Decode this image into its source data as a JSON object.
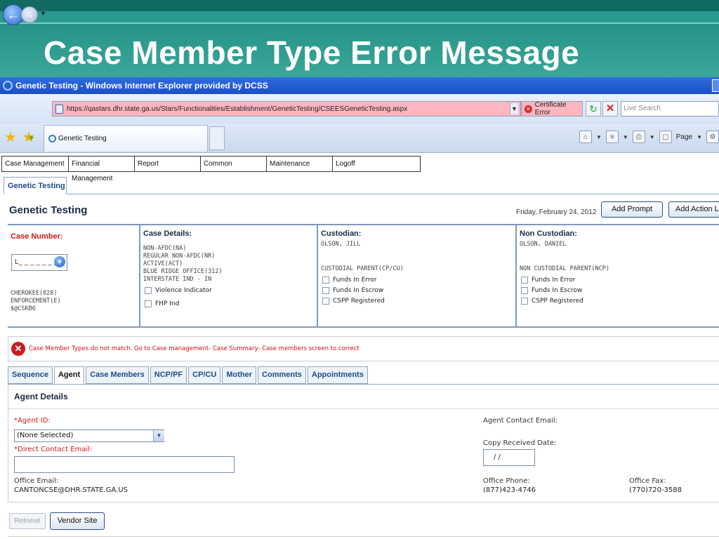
{
  "slide": {
    "title": "Case Member Type Error Message"
  },
  "browser": {
    "window_title": "Genetic Testing - Windows Internet Explorer provided by DCSS",
    "url": "https://qastars.dhr.state.ga.us/Stars/Functionalities/Establishment/GeneticTesting/CSEESGeneticTesting.aspx",
    "cert_error": "Certificate Error",
    "search_placeholder": "Live Search",
    "tab_label": "Genetic Testing",
    "page_menu": "Page"
  },
  "menu": {
    "items": [
      "Case Management",
      "Financial Management",
      "Report",
      "Common",
      "Maintenance",
      "Logoff"
    ]
  },
  "app": {
    "tab_label": "Genetic Testing",
    "heading": "Genetic Testing",
    "date": "Friday, February 24, 2012",
    "add_prompt": "Add Prompt",
    "add_action": "Add Action Lo"
  },
  "case": {
    "number_label": "Case Number:",
    "number_value": "L_ _ _ _ _ _ _",
    "county": "CHEROKEE(028)",
    "type": "ENFORCEMENT(E)",
    "code": "$@CSKB6",
    "details_label": "Case Details:",
    "details": [
      "NON-AFDC(NA)",
      "REGULAR NON-AFDC(NR)",
      "ACTIVE(ACT)",
      "BLUE RIDGE OFFICE(312)",
      "INTERSTATE IND - IN"
    ],
    "violence": "Violence Indicator",
    "fhp": "FHP Ind",
    "custodian_label": "Custodian:",
    "custodian_name": "OLSON, JILL",
    "custodian_role": "CUSTODIAL PARENT(CP/CU)",
    "cust_funds_error": "Funds In Error",
    "cust_funds_escrow": "Funds In Escrow",
    "cust_cspp": "CSPP Registered",
    "noncust_label": "Non Custodian:",
    "noncust_name": "OLSON, DANIEL",
    "noncust_role": "NON CUSTODIAL PARENT(NCP)",
    "nc_funds_error": "Funds In Error",
    "nc_funds_escrow": "Funds In Escrow",
    "nc_cspp": "CSPP Registered"
  },
  "error": {
    "message": "Case Member Types do not match. Go to Case management- Case Summary- Case members screen to correct"
  },
  "sub_tabs": [
    "Sequence",
    "Agent",
    "Case Members",
    "NCP/PF",
    "CP/CU",
    "Mother",
    "Comments",
    "Appointments"
  ],
  "agent": {
    "heading": "Agent Details",
    "id_label": "*Agent ID:",
    "id_value": "(None Selected)",
    "direct_email_label": "*Direct Contact Email:",
    "office_email_label": "Office Email:",
    "office_email": "CANTONCSE@DHR.STATE.GA.US",
    "contact_email_label": "Agent Contact Email:",
    "copy_date_label": "Copy Received Date:",
    "copy_date_value": "/     /",
    "office_phone_label": "Office Phone:",
    "office_phone": "(877)423-4746",
    "office_fax_label": "Office Fax:",
    "office_fax": "(770)720-3588"
  },
  "buttons": {
    "retrieve": "Retrieve",
    "vendor": "Vendor Site"
  },
  "colors": {
    "slide_bg": "#2b9a8e",
    "ie_title": "#1a4fc7",
    "error_red": "#c80f0f",
    "accent_blue": "#1c4c8a"
  }
}
